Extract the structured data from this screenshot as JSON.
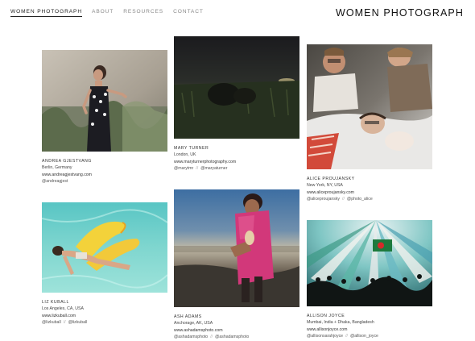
{
  "nav": {
    "items": [
      {
        "label": "WOMEN PHOTOGRAPH"
      },
      {
        "label": "ABOUT"
      },
      {
        "label": "RESOURCES"
      },
      {
        "label": "CONTACT"
      }
    ]
  },
  "brand": {
    "title": "WOMEN PHOTOGRAPH"
  },
  "separator": "//",
  "photographers": [
    {
      "name": "ANDREA GJESTVANG",
      "location": "Berlin, Germany",
      "website": "www.andreagjestvang.com",
      "handle1": "@andreagjest",
      "handle2": ""
    },
    {
      "name": "MARY TURNER",
      "location": "London, UK",
      "website": "www.maryturnerphotography.com",
      "handle1": "@marytmr",
      "handle2": "@maryaturner"
    },
    {
      "name": "ALICE PROUJANSKY",
      "location": "New York, NY, USA",
      "website": "www.aliceproujansky.com",
      "handle1": "@aliceproujansky",
      "handle2": "@photo_alice"
    },
    {
      "name": "LIZ KUBALL",
      "location": "Los Angeles, CA, USA",
      "website": "www.lizkuball.com",
      "handle1": "@lizkuball",
      "handle2": "@lizkuball"
    },
    {
      "name": "ASH ADAMS",
      "location": "Anchorage, AK, USA",
      "website": "www.ashadamsphoto.com",
      "handle1": "@ashadamsphoto",
      "handle2": "@ashadamsphoto"
    },
    {
      "name": "ALLISON JOYCE",
      "location": "Mumbai, India + Dhaka, Bangladesh",
      "website": "www.allisonjoyce.com",
      "handle1": "@allisonsarahjoyce",
      "handle2": "@allison_joyce"
    }
  ]
}
